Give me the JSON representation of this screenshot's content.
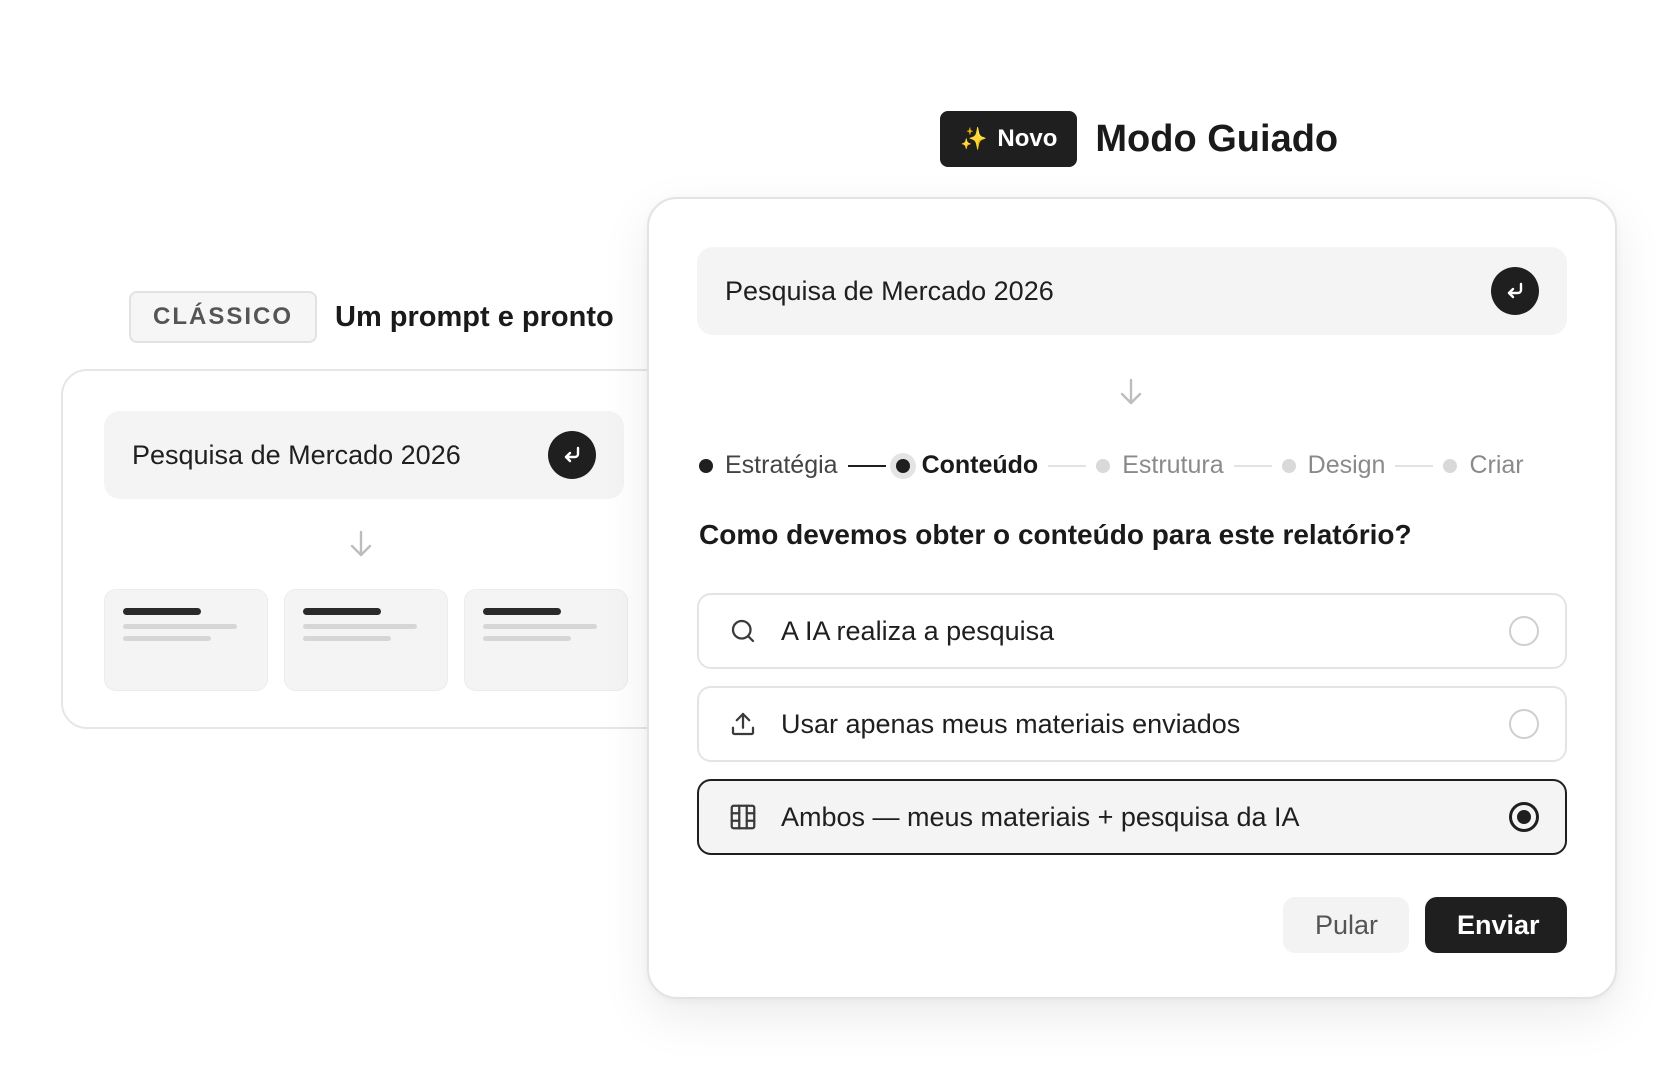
{
  "classic": {
    "badge": "CLÁSSICO",
    "title": "Um prompt e pronto",
    "prompt_value": "Pesquisa de Mercado 2026",
    "enter_icon": "enter-arrow-icon",
    "down_arrow_icon": "arrow-down-icon",
    "preview_cards": 3
  },
  "guided": {
    "badge_icon": "sparkles-icon",
    "badge": "Novo",
    "title": "Modo Guiado",
    "prompt_value": "Pesquisa de Mercado 2026",
    "enter_icon": "enter-arrow-icon",
    "down_arrow_icon": "arrow-down-icon",
    "steps": [
      {
        "label": "Estratégia",
        "state": "done"
      },
      {
        "label": "Conteúdo",
        "state": "active"
      },
      {
        "label": "Estrutura",
        "state": "pending"
      },
      {
        "label": "Design",
        "state": "pending"
      },
      {
        "label": "Criar",
        "state": "pending"
      }
    ],
    "question": "Como devemos obter o conteúdo para este relatório?",
    "options": [
      {
        "label": "A IA realiza a pesquisa",
        "icon": "search-icon",
        "selected": false
      },
      {
        "label": "Usar apenas meus materiais enviados",
        "icon": "upload-icon",
        "selected": false
      },
      {
        "label": "Ambos — meus materiais + pesquisa da IA",
        "icon": "grid-icon",
        "selected": true
      }
    ],
    "skip_label": "Pular",
    "submit_label": "Enviar"
  },
  "colors": {
    "accent": "#1f1f1f",
    "surface": "#f4f4f4",
    "border": "#e4e4e4",
    "sparkle": "#f5c542"
  }
}
